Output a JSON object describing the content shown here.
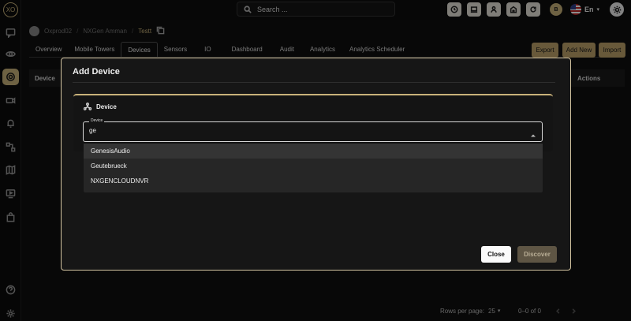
{
  "brand": {
    "logo_text": "XO"
  },
  "topbar": {
    "search_placeholder": "Search ...",
    "user_initials": "B",
    "language": "En"
  },
  "breadcrumb": {
    "items": [
      "Oxprod02",
      "NXGen Amman",
      "Testt"
    ]
  },
  "tabs": [
    "Overview",
    "Mobile Towers",
    "Devices",
    "Sensors",
    "IO",
    "Dashboard",
    "Audit",
    "Analytics",
    "Analytics Scheduler"
  ],
  "active_tab": "Devices",
  "actions": {
    "export": "Export",
    "add_new": "Add New",
    "import": "Import"
  },
  "table": {
    "col_device": "Device",
    "col_actions": "Actions"
  },
  "pagination": {
    "rows_label": "Rows per page:",
    "rows_value": "25",
    "range": "0–0 of 0"
  },
  "modal": {
    "title": "Add Device",
    "section": "Device",
    "field_label": "Device",
    "field_value": "ge",
    "options": [
      "GenesisAudio",
      "Geutebrueck",
      "NXGENCLOUDNVR"
    ],
    "close": "Close",
    "discover": "Discover"
  },
  "colors": {
    "accent": "#c9b27a",
    "background": "#0f0f0f",
    "modal_border": "#d2c3a0"
  }
}
